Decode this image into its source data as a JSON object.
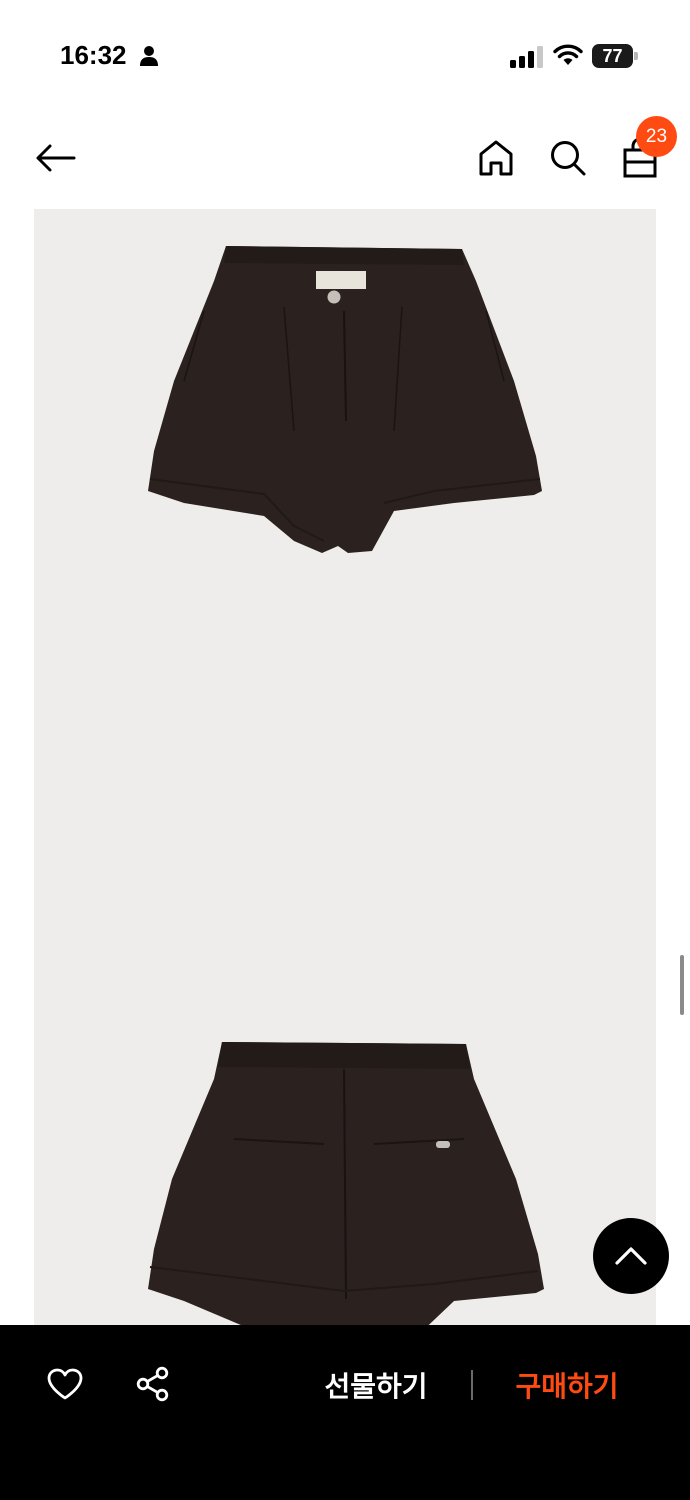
{
  "status_bar": {
    "time": "16:32",
    "battery_level": "77",
    "icons": [
      "person-icon",
      "cellular-signal-icon",
      "wifi-icon",
      "battery-icon"
    ]
  },
  "nav": {
    "icons": [
      "arrow-left-icon",
      "home-icon",
      "search-icon",
      "shopping-bag-icon"
    ],
    "cart_count": "23"
  },
  "product_images": {
    "items": [
      "shorts-front-view",
      "shorts-back-view"
    ],
    "background_color": "#eeedeb",
    "garment_color": "#2b221f"
  },
  "floating": {
    "scroll_top_icon": "chevron-up-icon"
  },
  "bottom_bar": {
    "like_icon": "heart-icon",
    "share_icon": "share-icon",
    "gift_label": "선물하기",
    "buy_label": "구매하기"
  },
  "colors": {
    "accent": "#ff4b12",
    "bar_background": "#000000"
  }
}
